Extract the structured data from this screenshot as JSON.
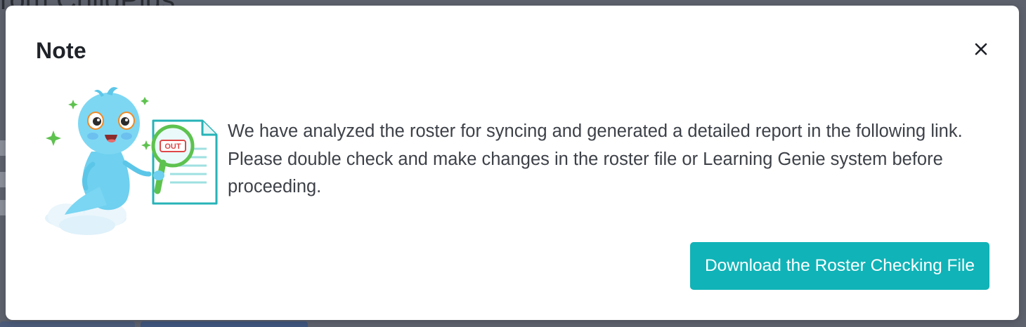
{
  "background": {
    "title_fragment": "rom ChildPlus"
  },
  "modal": {
    "title": "Note",
    "close_icon": "close-icon",
    "illustration_badge": "OUT",
    "message": "We have analyzed the roster for syncing and generated a detailed report in the following link. Please double check and make changes in the roster file or Learning Genie system before proceeding.",
    "download_button_label": "Download the Roster Checking File"
  },
  "colors": {
    "accent": "#10b3b7",
    "title": "#1f2329",
    "body_text": "#3d4148",
    "overlay": "#5d616c"
  }
}
